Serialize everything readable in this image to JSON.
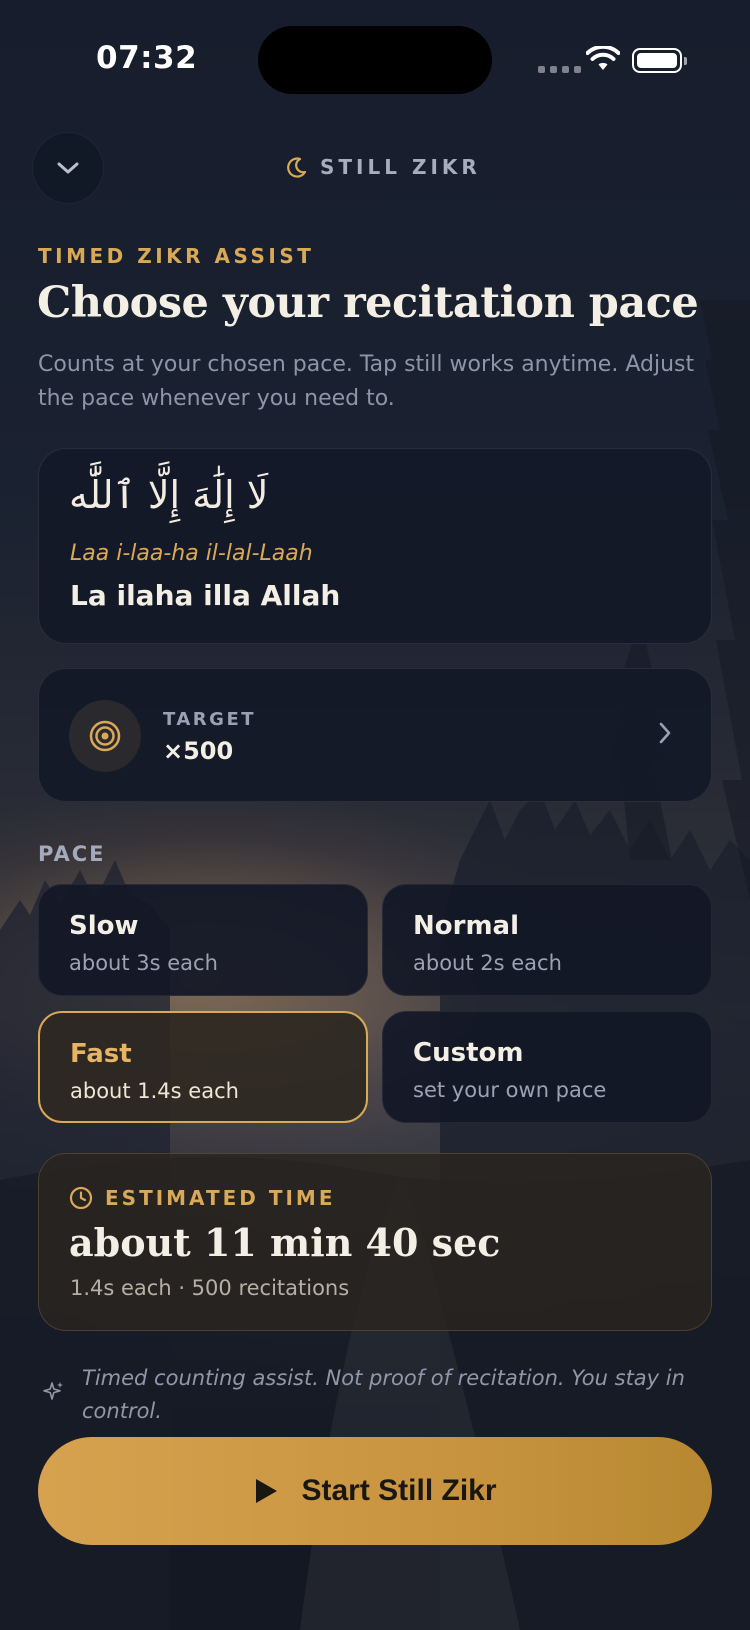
{
  "status": {
    "time": "07:32"
  },
  "header": {
    "brand": "STILL ZIKR",
    "back_icon": "chevron-down-icon",
    "brand_icon": "moon-icon"
  },
  "intro": {
    "eyebrow": "TIMED ZIKR ASSIST",
    "title": "Choose your recitation pace",
    "subtitle": "Counts at your chosen pace. Tap still works anytime. Adjust the pace whenever you need to."
  },
  "zikr": {
    "arabic": "لَا إِلَٰهَ إِلَّا ٱللَّٰه",
    "transliteration": "Laa i-laa-ha il-lal-Laah",
    "meaning": "La ilaha illa Allah"
  },
  "target": {
    "label": "TARGET",
    "value": "×500",
    "icon": "target-icon"
  },
  "pace": {
    "label": "PACE",
    "options": [
      {
        "name": "Slow",
        "sub": "about 3s each",
        "selected": false
      },
      {
        "name": "Normal",
        "sub": "about 2s each",
        "selected": false
      },
      {
        "name": "Fast",
        "sub": "about 1.4s each",
        "selected": true
      },
      {
        "name": "Custom",
        "sub": "set your own pace",
        "selected": false
      }
    ]
  },
  "estimate": {
    "label": "ESTIMATED TIME",
    "value": "about 11 min 40 sec",
    "sub": "1.4s each · 500 recitations"
  },
  "note": "Timed counting assist. Not proof of recitation. You stay in control.",
  "cta": {
    "label": "Start Still Zikr",
    "icon": "play-icon"
  },
  "colors": {
    "accent": "#d9a957",
    "background": "#121827",
    "card": "#131928",
    "button": "#d6a24f"
  }
}
